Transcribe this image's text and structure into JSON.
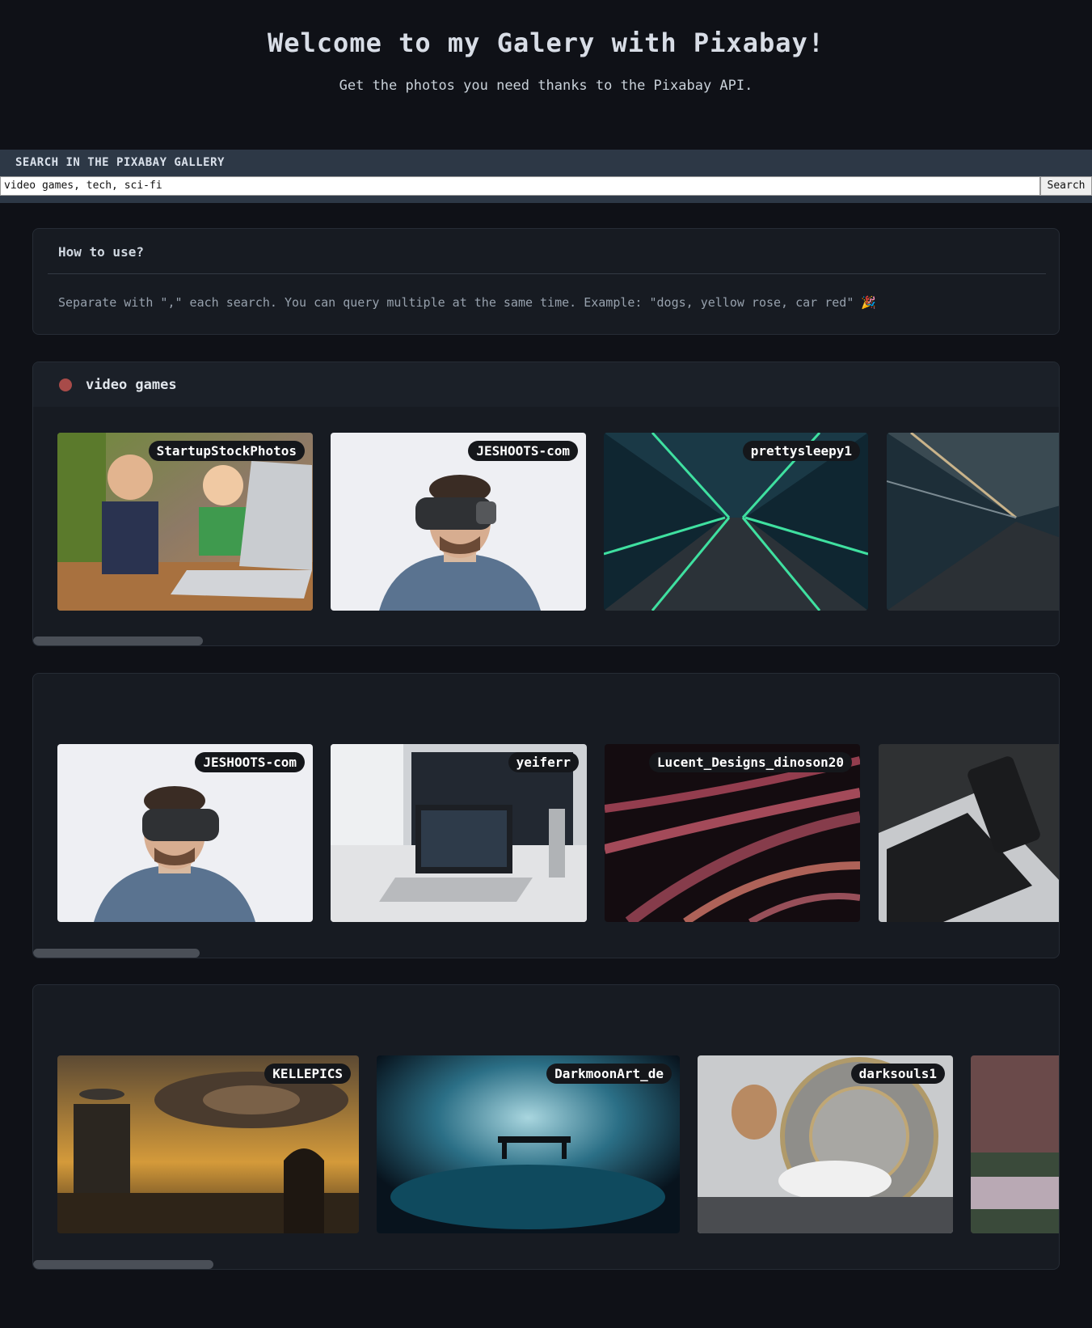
{
  "header": {
    "title": "Welcome to my Galery with Pixabay!",
    "subtitle": "Get the photos you need thanks to the Pixabay API."
  },
  "search": {
    "label": "SEARCH IN THE PIXABAY GALLERY",
    "value": "video games, tech, sci-fi",
    "button": "Search"
  },
  "howto": {
    "title": "How to use?",
    "text": "Separate with \",\" each search. You can query multiple at the same time. Example: \"dogs, yellow rose, car red\" 🎉"
  },
  "galleries": [
    {
      "title": "video games",
      "photos": [
        {
          "author": "StartupStockPhotos",
          "icon": "kids-laptop-photo"
        },
        {
          "author": "JESHOOTS-com",
          "icon": "vr-headset-photo"
        },
        {
          "author": "prettysleepy1",
          "icon": "neon-tunnel-photo"
        },
        {
          "author": "",
          "icon": "tunnel-photo"
        }
      ]
    },
    {
      "title": "",
      "photos": [
        {
          "author": "JESHOOTS-com",
          "icon": "vr-headset-photo"
        },
        {
          "author": "yeiferr",
          "icon": "desk-laptop-photo"
        },
        {
          "author": "Lucent_Designs_dinoson20",
          "icon": "fiber-optics-photo"
        },
        {
          "author": "",
          "icon": "laptop-keyboard-photo"
        }
      ]
    },
    {
      "title": "",
      "photos": [
        {
          "author": "KELLEPICS",
          "icon": "scifi-city-photo"
        },
        {
          "author": "DarkmoonArt_de",
          "icon": "fantasy-bench-photo"
        },
        {
          "author": "darksouls1",
          "icon": "steampunk-clock-photo"
        },
        {
          "author": "",
          "icon": "landscape-photo"
        }
      ]
    }
  ]
}
